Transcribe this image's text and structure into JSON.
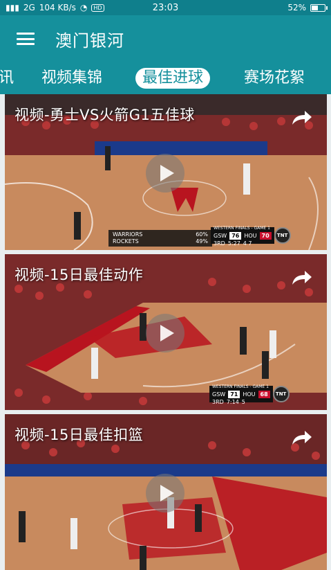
{
  "status_bar": {
    "signal": "2G",
    "net_speed": "104 KB/s",
    "hd": "HD",
    "time": "23:03",
    "battery": "52%",
    "battery_level": 0.52
  },
  "app_bar": {
    "title": "澳门银河"
  },
  "tabs": [
    {
      "label": "讯",
      "active": false
    },
    {
      "label": "视频集锦",
      "active": false
    },
    {
      "label": "最佳进球",
      "active": true
    },
    {
      "label": "赛场花絮",
      "active": false
    }
  ],
  "cards": [
    {
      "title": "视频-勇士VS火箭G1五佳球",
      "scorebug": {
        "header": "WESTERN FINALS - GAME 1",
        "away": "GSW",
        "away_score": "76",
        "home": "HOU",
        "home_score": "70",
        "period": "3RD",
        "clock": "5:27",
        "extra": "4 7",
        "network": "TNT"
      },
      "stats": [
        {
          "team": "WARRIORS",
          "pct": "60%"
        },
        {
          "team": "ROCKETS",
          "pct": "49%"
        }
      ]
    },
    {
      "title": "视频-15日最佳动作",
      "scorebug": {
        "header": "WESTERN FINALS - GAME 1",
        "away": "GSW",
        "away_score": "71",
        "home": "HOU",
        "home_score": "68",
        "period": "3RD",
        "clock": "7:14",
        "extra": "5",
        "network": "TNT"
      }
    },
    {
      "title": "视频-15日最佳扣篮"
    }
  ],
  "colors": {
    "brand": "#15909c",
    "status_bar": "#0f7f8c"
  }
}
